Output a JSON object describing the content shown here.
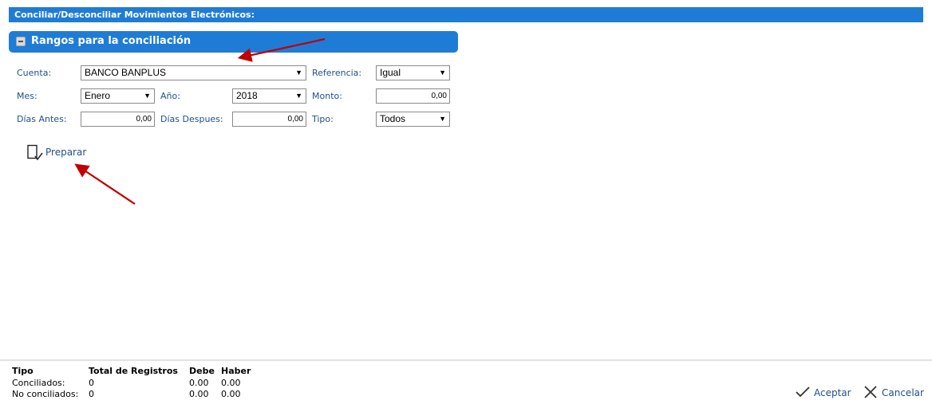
{
  "window": {
    "title": "Conciliar/Desconciliar Movimientos Electrónicos:"
  },
  "section": {
    "title": "Rangos para la conciliación"
  },
  "form": {
    "cuenta_label": "Cuenta:",
    "cuenta_value": "BANCO BANPLUS",
    "referencia_label": "Referencia:",
    "referencia_value": "Igual",
    "mes_label": "Mes:",
    "mes_value": "Enero",
    "anio_label": "Año:",
    "anio_value": "2018",
    "monto_label": "Monto:",
    "monto_value": "0,00",
    "dias_antes_label": "Días Antes:",
    "dias_antes_value": "0,00",
    "dias_despues_label": "Días Despues:",
    "dias_despues_value": "0,00",
    "tipo_label": "Tipo:",
    "tipo_value": "Todos",
    "dropdown_arrow": "▼"
  },
  "actions": {
    "preparar_label": "Preparar",
    "aceptar_label": "Aceptar",
    "cancelar_label": "Cancelar"
  },
  "summary": {
    "headers": [
      "Tipo",
      "Total de Registros",
      "Debe",
      "Haber"
    ],
    "rows": [
      {
        "tipo": "Conciliados:",
        "total": "0",
        "debe": "0.00",
        "haber": "0.00"
      },
      {
        "tipo": "No conciliados:",
        "total": "0",
        "debe": "0.00",
        "haber": "0.00"
      }
    ]
  },
  "colors": {
    "header_blue": "#1f7cd6",
    "label_blue": "#1f4f8f",
    "annotation_red": "#c00000"
  }
}
